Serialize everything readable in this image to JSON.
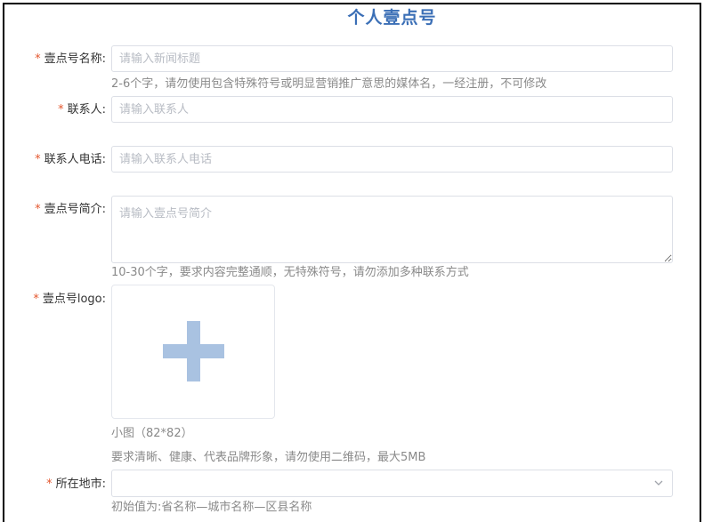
{
  "page": {
    "title": "个人壹点号"
  },
  "form": {
    "required_mark": "*",
    "name": {
      "label": "壹点号名称:",
      "placeholder": "请输入新闻标题",
      "value": "",
      "hint": "2-6个字，请勿使用包含特殊符号或明显营销推广意思的媒体名，一经注册，不可修改"
    },
    "contact": {
      "label": "联系人:",
      "placeholder": "请输入联系人",
      "value": ""
    },
    "phone": {
      "label": "联系人电话:",
      "placeholder": "请输入联系人电话",
      "value": ""
    },
    "intro": {
      "label": "壹点号简介:",
      "placeholder": "请输入壹点号简介",
      "value": "",
      "hint": "10-30个字，要求内容完整通顺，无特殊符号，请勿添加多种联系方式"
    },
    "logo": {
      "label": "壹点号logo:",
      "upload_icon": "plus-icon",
      "size_note": "小图（82*82）",
      "hint": "要求清晰、健康、代表品牌形象，请勿使用二维码，最大5MB"
    },
    "city": {
      "label": "所在地市:",
      "value": "",
      "dropdown_icon": "chevron-down-icon",
      "hint": "初始值为:省名称—城市名称—区县名称"
    }
  },
  "colors": {
    "title": "#3b6fb6",
    "required": "#e4572e",
    "plus": "#a9c2e1",
    "hint": "#8a8a8a",
    "border": "#dcdfe6"
  }
}
